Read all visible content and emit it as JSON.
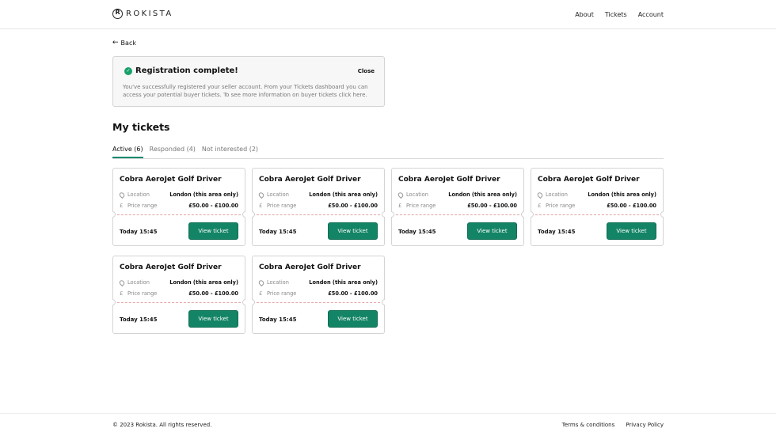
{
  "header": {
    "logo_text": "ROKISTA",
    "nav": [
      "About",
      "Tickets",
      "Account"
    ]
  },
  "back": {
    "label": "Back"
  },
  "alert": {
    "title": "Registration complete!",
    "close": "Close",
    "body": "You've successfully registered your seller account. From your Tickets dashboard you can access your potential buyer tickets. To see more information on buyer tickets click here."
  },
  "section": {
    "title": "My tickets"
  },
  "tabs": [
    "Active (6)",
    "Responded (4)",
    "Not interested (2)"
  ],
  "tickets": [
    {
      "title": "Cobra AeroJet Golf Driver",
      "location_label": "Location",
      "location": "London (this area only)",
      "price_label": "Price range",
      "price": "£50.00 - £100.00",
      "time": "Today 15:45",
      "button": "View ticket"
    },
    {
      "title": "Cobra AeroJet Golf Driver",
      "location_label": "Location",
      "location": "London (this area only)",
      "price_label": "Price range",
      "price": "£50.00 - £100.00",
      "time": "Today 15:45",
      "button": "View ticket"
    },
    {
      "title": "Cobra AeroJet Golf Driver",
      "location_label": "Location",
      "location": "London (this area only)",
      "price_label": "Price range",
      "price": "£50.00 - £100.00",
      "time": "Today 15:45",
      "button": "View ticket"
    },
    {
      "title": "Cobra AeroJet Golf Driver",
      "location_label": "Location",
      "location": "London (this area only)",
      "price_label": "Price range",
      "price": "£50.00 - £100.00",
      "time": "Today 15:45",
      "button": "View ticket"
    },
    {
      "title": "Cobra AeroJet Golf Driver",
      "location_label": "Location",
      "location": "London (this area only)",
      "price_label": "Price range",
      "price": "£50.00 - £100.00",
      "time": "Today 15:45",
      "button": "View ticket"
    },
    {
      "title": "Cobra AeroJet Golf Driver",
      "location_label": "Location",
      "location": "London (this area only)",
      "price_label": "Price range",
      "price": "£50.00 - £100.00",
      "time": "Today 15:45",
      "button": "View ticket"
    }
  ],
  "footer": {
    "copyright": "© 2023 Rokista. All rights reserved.",
    "links": [
      "Terms & conditions",
      "Privacy Policy"
    ]
  },
  "colors": {
    "accent": "#148466",
    "success": "#19a06a"
  }
}
